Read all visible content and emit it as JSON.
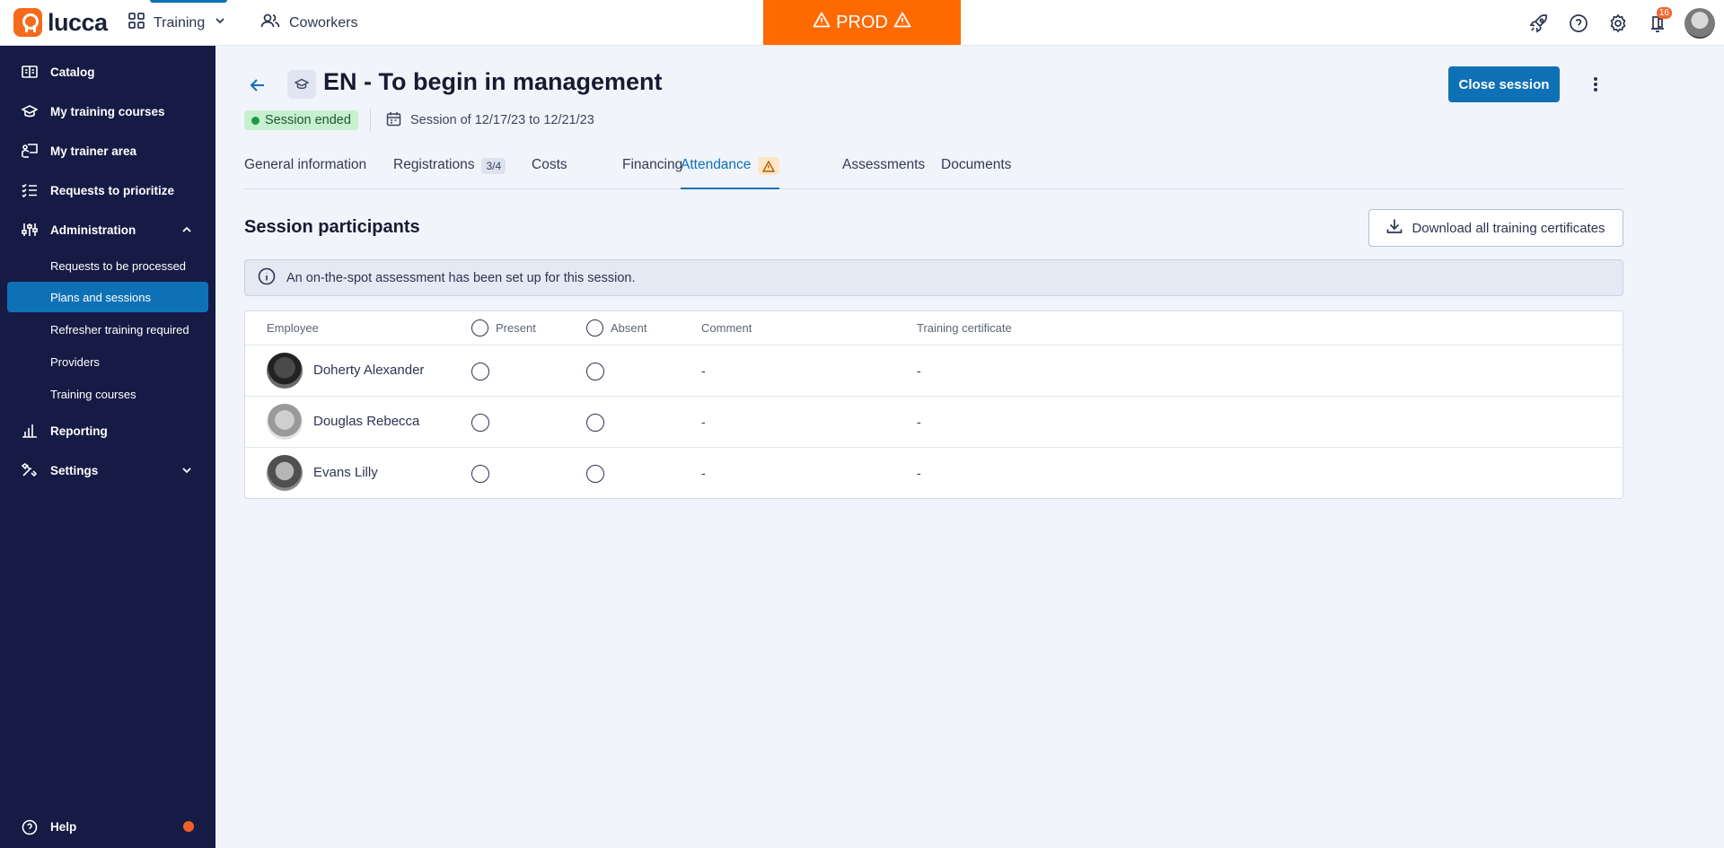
{
  "topbar": {
    "logo_text": "lucca",
    "app_name": "Training",
    "coworkers_label": "Coworkers",
    "prod_label": "PROD",
    "notifications_count": "16"
  },
  "sidebar": {
    "items": [
      {
        "label": "Catalog",
        "icon": "catalog-icon"
      },
      {
        "label": "My training courses",
        "icon": "graduation-cap-icon"
      },
      {
        "label": "My trainer area",
        "icon": "trainer-board-icon"
      },
      {
        "label": "Requests to prioritize",
        "icon": "list-check-icon"
      },
      {
        "label": "Administration",
        "icon": "sliders-icon"
      }
    ],
    "admin_subitems": [
      {
        "label": "Requests to be processed"
      },
      {
        "label": "Plans and sessions",
        "active": true
      },
      {
        "label": "Refresher training required"
      },
      {
        "label": "Providers"
      },
      {
        "label": "Training courses"
      }
    ],
    "reporting_label": "Reporting",
    "settings_label": "Settings",
    "help_label": "Help"
  },
  "header": {
    "title": "EN - To begin in management",
    "close_label": "Close session",
    "status": "Session ended",
    "dates": "Session of 12/17/23 to 12/21/23"
  },
  "tabs": [
    {
      "label": "General information"
    },
    {
      "label": "Registrations",
      "count": "3/4"
    },
    {
      "label": "Costs"
    },
    {
      "label": "Financing"
    },
    {
      "label": "Attendance",
      "active": true,
      "warning": true
    },
    {
      "label": "Assessments"
    },
    {
      "label": "Documents"
    }
  ],
  "section": {
    "title": "Session participants",
    "download_label": "Download all training certificates",
    "info_text": "An on-the-spot assessment has been set up for this session."
  },
  "table": {
    "columns": {
      "employee": "Employee",
      "present": "Present",
      "absent": "Absent",
      "comment": "Comment",
      "certificate": "Training certificate"
    },
    "rows": [
      {
        "name": "Doherty Alexander",
        "comment": "-",
        "certificate": "-"
      },
      {
        "name": "Douglas Rebecca",
        "comment": "-",
        "certificate": "-"
      },
      {
        "name": "Evans Lilly",
        "comment": "-",
        "certificate": "-"
      }
    ]
  },
  "colors": {
    "brand_orange": "#f56b1b",
    "prod_banner": "#ff6a00",
    "sidebar_bg": "#161b45",
    "primary_blue": "#0f71b5",
    "status_green": "#1d9a42"
  }
}
